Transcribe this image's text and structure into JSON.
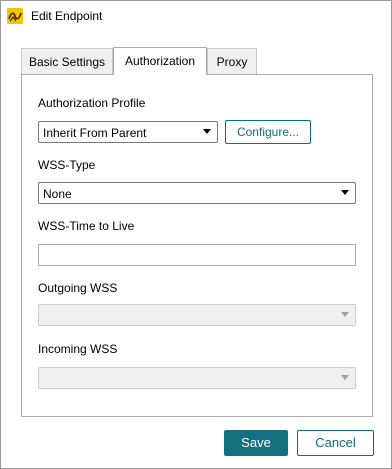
{
  "window": {
    "title": "Edit Endpoint",
    "app_icon": "application-logo-icon"
  },
  "tabs": [
    {
      "label": "Basic Settings",
      "active": false
    },
    {
      "label": "Authorization",
      "active": true
    },
    {
      "label": "Proxy",
      "active": false
    }
  ],
  "form": {
    "auth_profile": {
      "label": "Authorization Profile",
      "value": "Inherit From Parent",
      "configure_label": "Configure..."
    },
    "wss_type": {
      "label": "WSS-Type",
      "value": "None"
    },
    "wss_ttl": {
      "label": "WSS-Time to Live",
      "value": ""
    },
    "outgoing_wss": {
      "label": "Outgoing WSS",
      "value": "",
      "enabled": false
    },
    "incoming_wss": {
      "label": "Incoming WSS",
      "value": "",
      "enabled": false
    }
  },
  "footer": {
    "save_label": "Save",
    "cancel_label": "Cancel"
  },
  "colors": {
    "accent": "#15707f",
    "accent_text": "#0b6d80"
  }
}
